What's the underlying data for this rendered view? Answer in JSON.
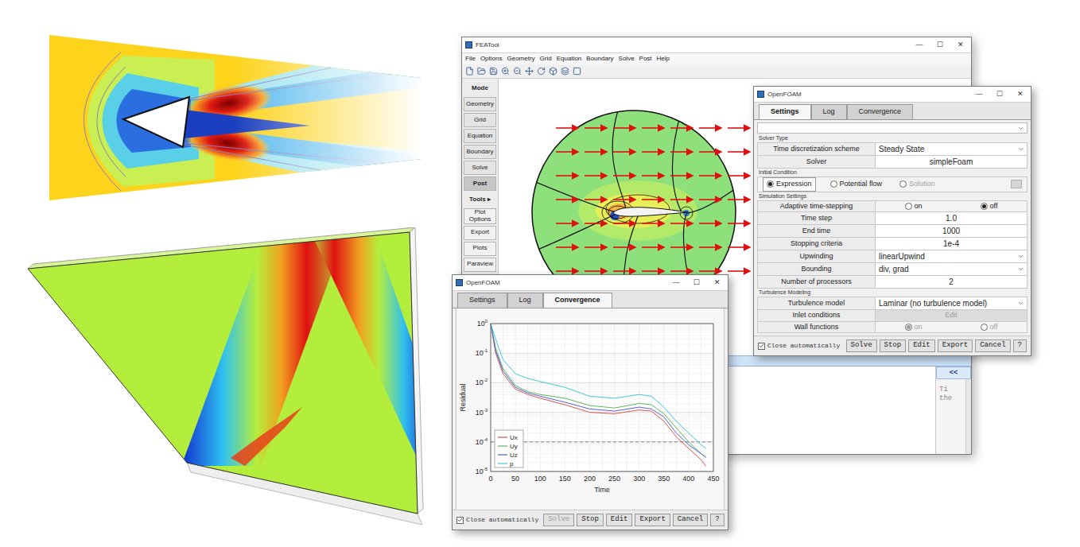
{
  "main_window": {
    "title": "FEATool",
    "controls": [
      "—",
      "☐",
      "✕"
    ],
    "menu": [
      "File",
      "Options",
      "Geometry",
      "Grid",
      "Equation",
      "Boundary",
      "Solve",
      "Post",
      "Help"
    ],
    "sidebar": [
      {
        "label": "Mode",
        "kind": "header",
        "selected": false
      },
      {
        "label": "Geometry",
        "kind": "mode",
        "selected": false
      },
      {
        "label": "Grid",
        "kind": "mode",
        "selected": false
      },
      {
        "label": "Equation",
        "kind": "mode",
        "selected": false
      },
      {
        "label": "Boundary",
        "kind": "mode",
        "selected": false
      },
      {
        "label": "Solve",
        "kind": "mode",
        "selected": false
      },
      {
        "label": "Post",
        "kind": "mode",
        "selected": true
      },
      {
        "label": "Tools ▸",
        "kind": "header",
        "selected": false
      },
      {
        "label": "Plot Options",
        "kind": "tool",
        "selected": false
      },
      {
        "label": "Export",
        "kind": "tool",
        "selected": false
      },
      {
        "label": "Plots",
        "kind": "tool",
        "selected": false
      },
      {
        "label": "Paraview",
        "kind": "tool",
        "selected": false
      }
    ],
    "command": {
      "button": "<<",
      "lines": [
        "Ti",
        "the"
      ]
    }
  },
  "settings_window": {
    "title": "OpenFOAM",
    "controls": [
      "—",
      "☐",
      "✕"
    ],
    "tabs": [
      {
        "label": "Settings",
        "selected": true
      },
      {
        "label": "Log",
        "selected": false
      },
      {
        "label": "Convergence",
        "selected": false
      }
    ],
    "sections": [
      {
        "title": "Solver Type",
        "rows": [
          {
            "kind": "select",
            "label": "Time discretization scheme",
            "value": "Steady State",
            "disabled": false
          },
          {
            "kind": "text",
            "label": "Solver",
            "value": "simpleFoam",
            "disabled": false
          }
        ]
      },
      {
        "title": "Initial Condition",
        "rows": [
          {
            "kind": "choice",
            "disabled": false,
            "options": [
              {
                "label": "Expression",
                "selected": true,
                "disabled": false
              },
              {
                "label": "Potential flow",
                "selected": false,
                "disabled": false
              },
              {
                "label": "Solution",
                "selected": false,
                "disabled": true
              }
            ]
          }
        ]
      },
      {
        "title": "Simulation Settings",
        "rows": [
          {
            "kind": "radios",
            "label": "Adaptive time-stepping",
            "disabled": false,
            "options": [
              {
                "label": "on",
                "selected": false,
                "disabled": false
              },
              {
                "label": "off",
                "selected": true,
                "disabled": false
              }
            ]
          },
          {
            "kind": "text",
            "label": "Time step",
            "value": "1.0",
            "disabled": false
          },
          {
            "kind": "text",
            "label": "End time",
            "value": "1000",
            "disabled": false
          },
          {
            "kind": "text",
            "label": "Stopping criteria",
            "value": "1e-4",
            "disabled": false
          },
          {
            "kind": "select",
            "label": "Upwinding",
            "value": "linearUpwind",
            "disabled": false
          },
          {
            "kind": "select",
            "label": "Bounding",
            "value": "div, grad",
            "disabled": false
          },
          {
            "kind": "text",
            "label": "Number of processors",
            "value": "2",
            "disabled": false
          }
        ]
      },
      {
        "title": "Turbulence Modeling",
        "rows": [
          {
            "kind": "select",
            "label": "Turbulence model",
            "value": "Laminar (no turbulence model)",
            "disabled": false
          },
          {
            "kind": "button",
            "label": "Inlet conditions",
            "value": "Edit",
            "disabled": true
          },
          {
            "kind": "radios",
            "label": "Wall functions",
            "disabled": true,
            "options": [
              {
                "label": "on",
                "selected": true,
                "disabled": true
              },
              {
                "label": "off",
                "selected": false,
                "disabled": true
              }
            ]
          }
        ]
      }
    ],
    "close_automatically": {
      "label": "Close automatically",
      "checked": true
    },
    "buttons": [
      {
        "label": "Solve",
        "disabled": false
      },
      {
        "label": "Stop",
        "disabled": false
      },
      {
        "label": "Edit",
        "disabled": false
      },
      {
        "label": "Export",
        "disabled": false
      },
      {
        "label": "Cancel",
        "disabled": false
      },
      {
        "label": "?",
        "disabled": false
      }
    ]
  },
  "convergence_window": {
    "title": "OpenFOAM",
    "controls": [
      "—",
      "☐",
      "✕"
    ],
    "tabs": [
      {
        "label": "Settings",
        "selected": false
      },
      {
        "label": "Log",
        "selected": false
      },
      {
        "label": "Convergence",
        "selected": true
      }
    ],
    "chart": {
      "y_label": "Residual",
      "x_label": "Time",
      "y_ticks": [
        {
          "base": "10",
          "exp": "0"
        },
        {
          "base": "10",
          "exp": "-1"
        },
        {
          "base": "10",
          "exp": "-2"
        },
        {
          "base": "10",
          "exp": "-3"
        },
        {
          "base": "10",
          "exp": "-4"
        },
        {
          "base": "10",
          "exp": "-5"
        }
      ],
      "x_ticks": [
        "0",
        "50",
        "100",
        "150",
        "200",
        "250",
        "300",
        "350",
        "400",
        "450"
      ],
      "stop_level": 0.0001,
      "time": [
        0,
        10,
        25,
        50,
        75,
        100,
        150,
        200,
        250,
        300,
        325,
        350,
        375,
        400,
        425,
        435
      ],
      "series": [
        {
          "label": "Ux",
          "color": "#d9534f",
          "values": [
            1,
            0.1,
            0.02,
            0.006,
            0.004,
            0.003,
            0.0018,
            0.001,
            0.0009,
            0.0012,
            0.0011,
            0.0005,
            0.00015,
            6e-05,
            2.5e-05,
            1.5e-05
          ]
        },
        {
          "label": "Uy",
          "color": "#5cb85c",
          "values": [
            1,
            0.15,
            0.03,
            0.008,
            0.005,
            0.004,
            0.003,
            0.0017,
            0.0014,
            0.002,
            0.0018,
            0.0009,
            0.0003,
            0.0001,
            4e-05,
            3e-05
          ]
        },
        {
          "label": "Uz",
          "color": "#5b5fd6",
          "values": [
            1,
            0.12,
            0.025,
            0.007,
            0.0045,
            0.0035,
            0.0022,
            0.0013,
            0.0011,
            0.0015,
            0.0013,
            0.0007,
            0.0002,
            8e-05,
            4e-05,
            3e-05
          ]
        },
        {
          "label": "p",
          "color": "#3fc6d8",
          "values": [
            1,
            0.3,
            0.06,
            0.02,
            0.014,
            0.011,
            0.007,
            0.0035,
            0.003,
            0.004,
            0.0035,
            0.0015,
            0.0005,
            0.0002,
            8e-05,
            6e-05
          ]
        }
      ]
    },
    "close_automatically": {
      "label": "Close automatically",
      "checked": true
    },
    "buttons": [
      {
        "label": "Solve",
        "disabled": true
      },
      {
        "label": "Stop",
        "disabled": false
      },
      {
        "label": "Edit",
        "disabled": false
      },
      {
        "label": "Export",
        "disabled": false
      },
      {
        "label": "Cancel",
        "disabled": false
      },
      {
        "label": "?",
        "disabled": false
      }
    ]
  }
}
